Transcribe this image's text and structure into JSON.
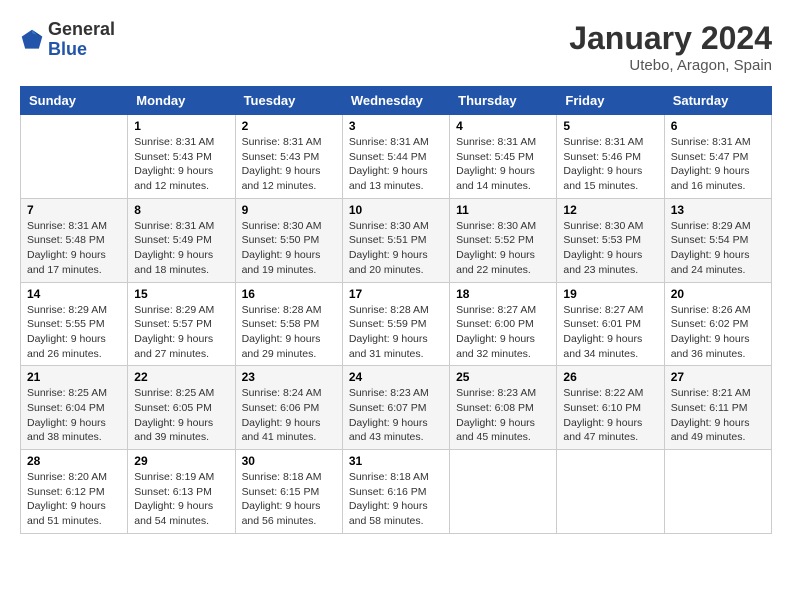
{
  "header": {
    "logo_general": "General",
    "logo_blue": "Blue",
    "month_title": "January 2024",
    "location": "Utebo, Aragon, Spain"
  },
  "days_of_week": [
    "Sunday",
    "Monday",
    "Tuesday",
    "Wednesday",
    "Thursday",
    "Friday",
    "Saturday"
  ],
  "weeks": [
    [
      {
        "day": "",
        "info": ""
      },
      {
        "day": "1",
        "info": "Sunrise: 8:31 AM\nSunset: 5:43 PM\nDaylight: 9 hours\nand 12 minutes."
      },
      {
        "day": "2",
        "info": "Sunrise: 8:31 AM\nSunset: 5:43 PM\nDaylight: 9 hours\nand 12 minutes."
      },
      {
        "day": "3",
        "info": "Sunrise: 8:31 AM\nSunset: 5:44 PM\nDaylight: 9 hours\nand 13 minutes."
      },
      {
        "day": "4",
        "info": "Sunrise: 8:31 AM\nSunset: 5:45 PM\nDaylight: 9 hours\nand 14 minutes."
      },
      {
        "day": "5",
        "info": "Sunrise: 8:31 AM\nSunset: 5:46 PM\nDaylight: 9 hours\nand 15 minutes."
      },
      {
        "day": "6",
        "info": "Sunrise: 8:31 AM\nSunset: 5:47 PM\nDaylight: 9 hours\nand 16 minutes."
      }
    ],
    [
      {
        "day": "7",
        "info": "Sunrise: 8:31 AM\nSunset: 5:48 PM\nDaylight: 9 hours\nand 17 minutes."
      },
      {
        "day": "8",
        "info": "Sunrise: 8:31 AM\nSunset: 5:49 PM\nDaylight: 9 hours\nand 18 minutes."
      },
      {
        "day": "9",
        "info": "Sunrise: 8:30 AM\nSunset: 5:50 PM\nDaylight: 9 hours\nand 19 minutes."
      },
      {
        "day": "10",
        "info": "Sunrise: 8:30 AM\nSunset: 5:51 PM\nDaylight: 9 hours\nand 20 minutes."
      },
      {
        "day": "11",
        "info": "Sunrise: 8:30 AM\nSunset: 5:52 PM\nDaylight: 9 hours\nand 22 minutes."
      },
      {
        "day": "12",
        "info": "Sunrise: 8:30 AM\nSunset: 5:53 PM\nDaylight: 9 hours\nand 23 minutes."
      },
      {
        "day": "13",
        "info": "Sunrise: 8:29 AM\nSunset: 5:54 PM\nDaylight: 9 hours\nand 24 minutes."
      }
    ],
    [
      {
        "day": "14",
        "info": "Sunrise: 8:29 AM\nSunset: 5:55 PM\nDaylight: 9 hours\nand 26 minutes."
      },
      {
        "day": "15",
        "info": "Sunrise: 8:29 AM\nSunset: 5:57 PM\nDaylight: 9 hours\nand 27 minutes."
      },
      {
        "day": "16",
        "info": "Sunrise: 8:28 AM\nSunset: 5:58 PM\nDaylight: 9 hours\nand 29 minutes."
      },
      {
        "day": "17",
        "info": "Sunrise: 8:28 AM\nSunset: 5:59 PM\nDaylight: 9 hours\nand 31 minutes."
      },
      {
        "day": "18",
        "info": "Sunrise: 8:27 AM\nSunset: 6:00 PM\nDaylight: 9 hours\nand 32 minutes."
      },
      {
        "day": "19",
        "info": "Sunrise: 8:27 AM\nSunset: 6:01 PM\nDaylight: 9 hours\nand 34 minutes."
      },
      {
        "day": "20",
        "info": "Sunrise: 8:26 AM\nSunset: 6:02 PM\nDaylight: 9 hours\nand 36 minutes."
      }
    ],
    [
      {
        "day": "21",
        "info": "Sunrise: 8:25 AM\nSunset: 6:04 PM\nDaylight: 9 hours\nand 38 minutes."
      },
      {
        "day": "22",
        "info": "Sunrise: 8:25 AM\nSunset: 6:05 PM\nDaylight: 9 hours\nand 39 minutes."
      },
      {
        "day": "23",
        "info": "Sunrise: 8:24 AM\nSunset: 6:06 PM\nDaylight: 9 hours\nand 41 minutes."
      },
      {
        "day": "24",
        "info": "Sunrise: 8:23 AM\nSunset: 6:07 PM\nDaylight: 9 hours\nand 43 minutes."
      },
      {
        "day": "25",
        "info": "Sunrise: 8:23 AM\nSunset: 6:08 PM\nDaylight: 9 hours\nand 45 minutes."
      },
      {
        "day": "26",
        "info": "Sunrise: 8:22 AM\nSunset: 6:10 PM\nDaylight: 9 hours\nand 47 minutes."
      },
      {
        "day": "27",
        "info": "Sunrise: 8:21 AM\nSunset: 6:11 PM\nDaylight: 9 hours\nand 49 minutes."
      }
    ],
    [
      {
        "day": "28",
        "info": "Sunrise: 8:20 AM\nSunset: 6:12 PM\nDaylight: 9 hours\nand 51 minutes."
      },
      {
        "day": "29",
        "info": "Sunrise: 8:19 AM\nSunset: 6:13 PM\nDaylight: 9 hours\nand 54 minutes."
      },
      {
        "day": "30",
        "info": "Sunrise: 8:18 AM\nSunset: 6:15 PM\nDaylight: 9 hours\nand 56 minutes."
      },
      {
        "day": "31",
        "info": "Sunrise: 8:18 AM\nSunset: 6:16 PM\nDaylight: 9 hours\nand 58 minutes."
      },
      {
        "day": "",
        "info": ""
      },
      {
        "day": "",
        "info": ""
      },
      {
        "day": "",
        "info": ""
      }
    ]
  ]
}
